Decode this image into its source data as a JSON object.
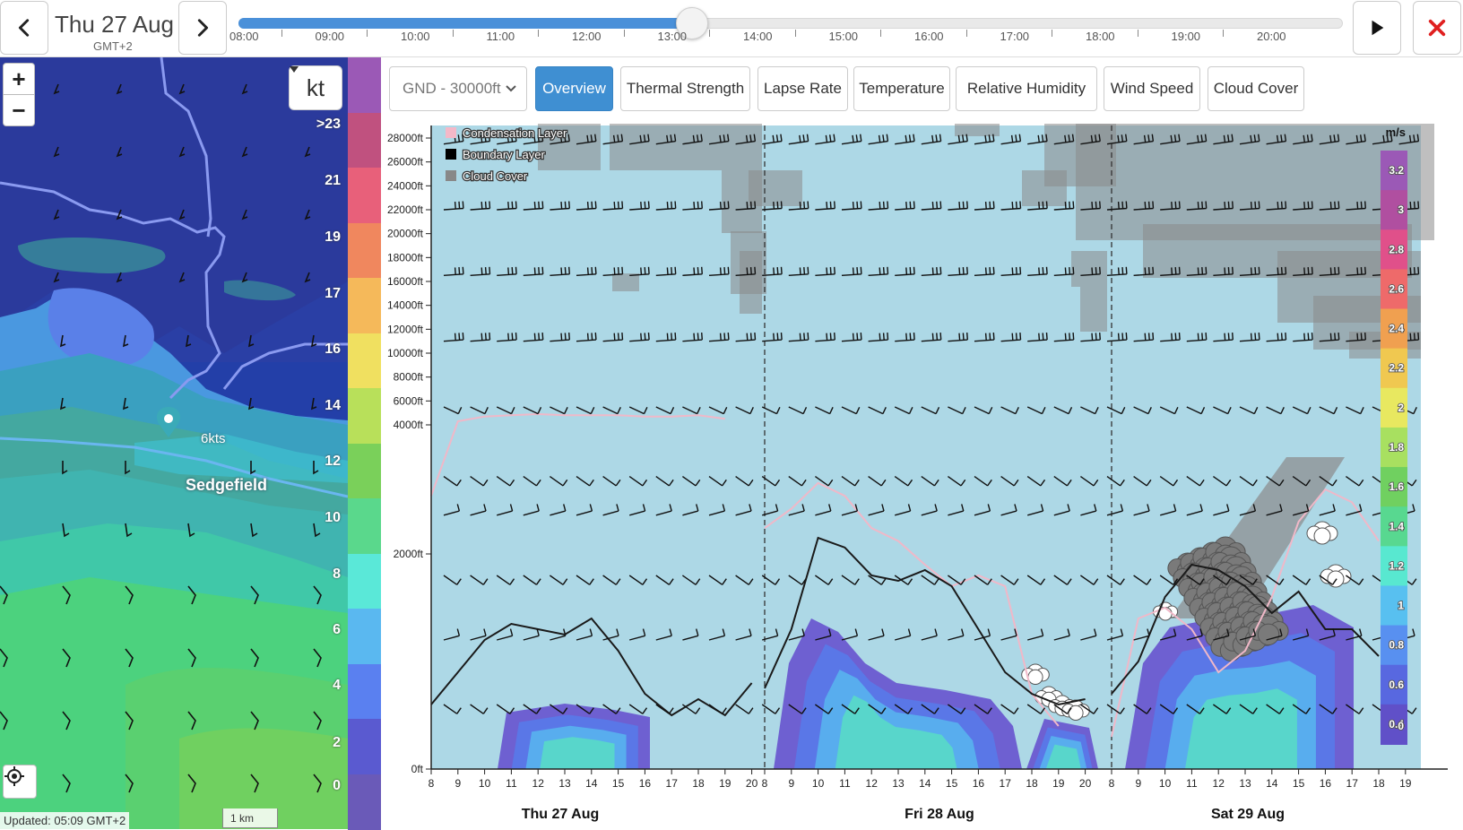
{
  "topbar": {
    "date": "Thu 27 Aug",
    "timezone": "GMT+2",
    "timeline_ticks": [
      "08:00",
      "09:00",
      "10:00",
      "11:00",
      "12:00",
      "13:00",
      "14:00",
      "15:00",
      "16:00",
      "17:00",
      "18:00",
      "19:00",
      "20:00"
    ],
    "timeline_progress": 0.411
  },
  "map": {
    "unit": "kt",
    "town": "Sedgefield",
    "wind_value": "6kts",
    "scale": "1 km",
    "updated": "Updated: 05:09 GMT+2",
    "zoom_in": "+",
    "zoom_out": "−",
    "kt_legend_labels": [
      ">23",
      "21",
      "19",
      "17",
      "16",
      "14",
      "12",
      "10",
      "8",
      "6",
      "4",
      "2",
      "0"
    ],
    "kt_legend_colors": [
      "#9b59b6",
      "#c0517f",
      "#e8607a",
      "#f0875e",
      "#f5b95a",
      "#f0e060",
      "#b8e05a",
      "#7ad05a",
      "#5ad88c",
      "#5ae8d8",
      "#5ab8f0",
      "#5a80f0",
      "#5a5ad0",
      "#6a5ab8"
    ]
  },
  "tabs": {
    "altitude": "GND - 30000ft",
    "items": [
      "Overview",
      "Thermal Strength",
      "Lapse Rate",
      "Temperature",
      "Relative Humidity",
      "Wind Speed",
      "Cloud Cover"
    ],
    "active": "Overview"
  },
  "chart_data": {
    "type": "area",
    "legend": [
      "Condensation Layer",
      "Boundary Layer",
      "Cloud Cover"
    ],
    "y_axis_labels": [
      "28000ft",
      "26000ft",
      "24000ft",
      "22000ft",
      "20000ft",
      "18000ft",
      "16000ft",
      "14000ft",
      "12000ft",
      "10000ft",
      "8000ft",
      "6000ft",
      "4000ft",
      "2000ft",
      "0ft"
    ],
    "x_hours": [
      8,
      9,
      10,
      11,
      12,
      13,
      14,
      15,
      16,
      17,
      18,
      19,
      20
    ],
    "day_labels": [
      "Thu 27 Aug",
      "Fri 28 Aug",
      "Sat 29 Aug"
    ],
    "colorscale_unit": "m/s",
    "colorscale_labels": [
      "3.2",
      "3",
      "2.8",
      "2.6",
      "2.4",
      "2.2",
      "2",
      "1.8",
      "1.6",
      "1.4",
      "1.2",
      "1",
      "0.8",
      "0.6",
      "0.4",
      "0"
    ],
    "colorscale_colors": [
      "#9b59b6",
      "#b04fa0",
      "#e0508a",
      "#ee6a6a",
      "#f0a050",
      "#f0c850",
      "#e8e860",
      "#a8e060",
      "#70d060",
      "#58d890",
      "#58e8d0",
      "#58c0f0",
      "#5890f0",
      "#5868e0",
      "#6050c8",
      "#ffffff"
    ],
    "boundary_layer_ft": [
      [
        600,
        900,
        1200,
        1350,
        1300,
        1250,
        1400,
        1100,
        700,
        500,
        650,
        500,
        800
      ],
      [
        750,
        1300,
        2250,
        2100,
        1800,
        1750,
        1850,
        1700,
        1300,
        900,
        700,
        600,
        650
      ],
      [
        700,
        1000,
        1600,
        1900,
        1850,
        1700,
        1450,
        1650,
        1300,
        1300,
        1050
      ]
    ],
    "condensation_layer_ft": [
      [
        2900,
        4300,
        4700,
        4800,
        4900,
        4800,
        4800,
        4800,
        4700,
        4700,
        4800,
        4500
      ],
      [
        2400,
        2700,
        3100,
        2900,
        2400,
        2200,
        1900,
        1700,
        1800,
        1700,
        700,
        400
      ],
      [
        300,
        1400,
        1500,
        1300,
        900,
        1100,
        1600,
        2500,
        3000,
        2800,
        2200
      ]
    ]
  }
}
